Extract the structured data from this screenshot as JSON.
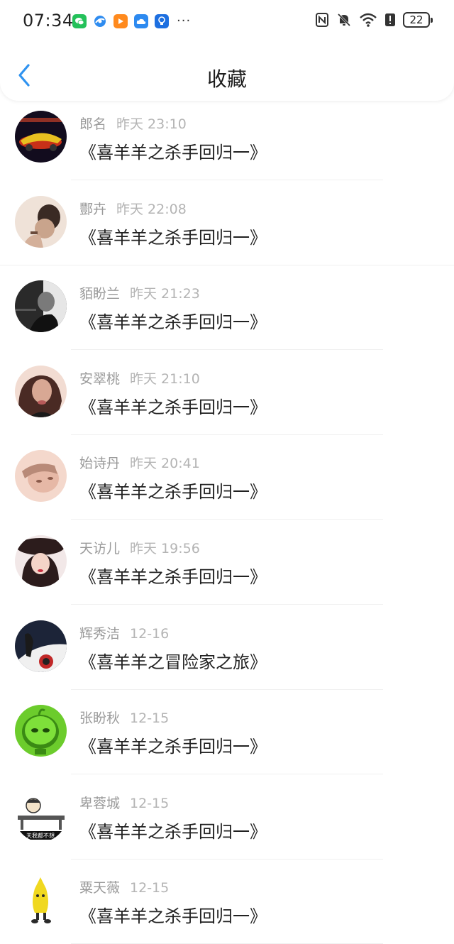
{
  "status_bar": {
    "time": "07:34",
    "notification_icons": [
      "wechat-icon",
      "browser-icon",
      "video-app-icon",
      "cloud-app-icon",
      "lightbulb-app-icon"
    ],
    "more": "···",
    "system_icons": [
      "nfc-icon",
      "mute-bell-icon",
      "wifi-icon",
      "alert-icon"
    ],
    "battery": "22"
  },
  "nav": {
    "title": "收藏",
    "back_icon": "chevron-left-icon"
  },
  "items": [
    {
      "name": "郎名",
      "time": "昨天 23:10",
      "title": "《喜羊羊之杀手回归一》",
      "avatar_colors": [
        "#120c1e",
        "#c83018",
        "#e8c020"
      ]
    },
    {
      "name": "酆卉",
      "time": "昨天 22:08",
      "title": "《喜羊羊之杀手回归一》",
      "avatar_colors": [
        "#efe2d8",
        "#3a2a24",
        "#c9a48c"
      ]
    },
    {
      "name": "貊盼兰",
      "time": "昨天 21:23",
      "title": "《喜羊羊之杀手回归一》",
      "avatar_colors": [
        "#2a2a2a",
        "#e6e6e6",
        "#7a7a7a"
      ]
    },
    {
      "name": "安翠桃",
      "time": "昨天 21:10",
      "title": "《喜羊羊之杀手回归一》",
      "avatar_colors": [
        "#f2dcd2",
        "#4a2a24",
        "#d8a894"
      ]
    },
    {
      "name": "始诗丹",
      "time": "昨天 20:41",
      "title": "《喜羊羊之杀手回归一》",
      "avatar_colors": [
        "#f4d8cc",
        "#b88a78",
        "#e6b8a6"
      ]
    },
    {
      "name": "天访儿",
      "time": "昨天 19:56",
      "title": "《喜羊羊之杀手回归一》",
      "avatar_colors": [
        "#f2e8e8",
        "#2c1c1c",
        "#c83040"
      ]
    },
    {
      "name": "辉秀洁",
      "time": "12-16",
      "title": "《喜羊羊之冒险家之旅》",
      "avatar_colors": [
        "#1c2438",
        "#f0f0f0",
        "#c02828"
      ]
    },
    {
      "name": "张盼秋",
      "time": "12-15",
      "title": "《喜羊羊之杀手回归一》",
      "avatar_colors": [
        "#ffffff",
        "#6ccc2c",
        "#3a8a14"
      ]
    },
    {
      "name": "卑蓉城",
      "time": "12-15",
      "title": "《喜羊羊之杀手回归一》",
      "avatar_colors": [
        "#ffffff",
        "#333333",
        "#d8c8a8"
      ],
      "avatar_caption": "天我都不想"
    },
    {
      "name": "粟天薇",
      "time": "12-15",
      "title": "《喜羊羊之杀手回归一》",
      "avatar_colors": [
        "#ffffff",
        "#f0d820",
        "#2a2a2a"
      ]
    }
  ]
}
